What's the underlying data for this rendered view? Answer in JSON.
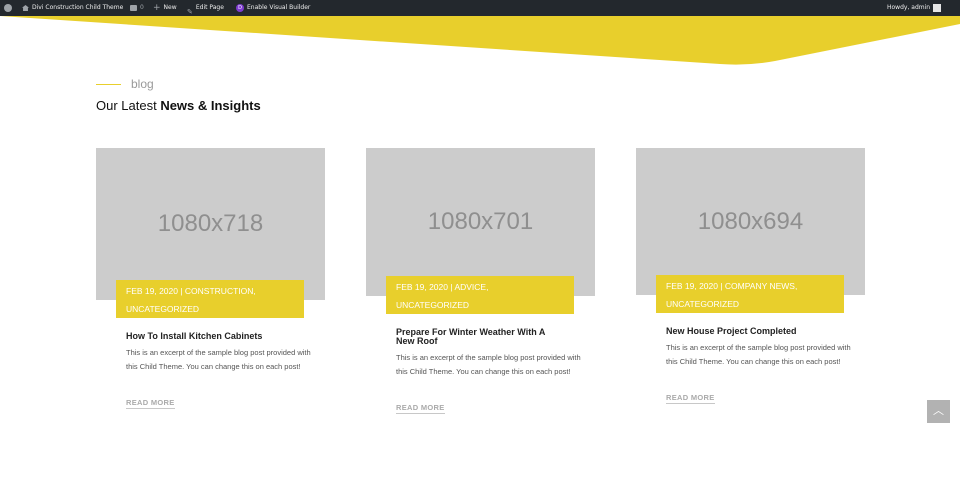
{
  "adminbar": {
    "site_name": "Divi Construction Child Theme",
    "comments_count": "0",
    "new_label": "New",
    "edit_label": "Edit Page",
    "visual_builder_label": "Enable Visual Builder",
    "howdy": "Howdy, admin"
  },
  "colors": {
    "accent": "#e8cf2c",
    "admin_bar": "#23282d",
    "placeholder": "#cccccc"
  },
  "section": {
    "label": "blog",
    "title_light": "Our Latest ",
    "title_bold": "News & Insights"
  },
  "posts": [
    {
      "thumb": "1080x718",
      "date": "FEB 19, 2020",
      "sep": " | ",
      "cats_line1": "CONSTRUCTION,",
      "cats_line2": "UNCATEGORIZED",
      "title": "How To Install Kitchen Cabinets",
      "excerpt": "This is an excerpt of the sample blog post provided with this Child Theme. You can change this on each post!",
      "more": "READ MORE"
    },
    {
      "thumb": "1080x701",
      "date": "FEB 19, 2020",
      "sep": " | ",
      "cats_line1": "ADVICE,",
      "cats_line2": "UNCATEGORIZED",
      "title": "Prepare For Winter Weather With A New Roof",
      "excerpt": "This is an excerpt of the sample blog post provided with this Child Theme. You can change this on each post!",
      "more": "READ MORE"
    },
    {
      "thumb": "1080x694",
      "date": "FEB 19, 2020",
      "sep": " | ",
      "cats_line1": "COMPANY NEWS,",
      "cats_line2": "UNCATEGORIZED",
      "title": "New House Project Completed",
      "excerpt": "This is an excerpt of the sample blog post provided with this Child Theme. You can change this on each post!",
      "more": "READ MORE"
    }
  ],
  "back_to_top_icon": "chevron-up-icon"
}
